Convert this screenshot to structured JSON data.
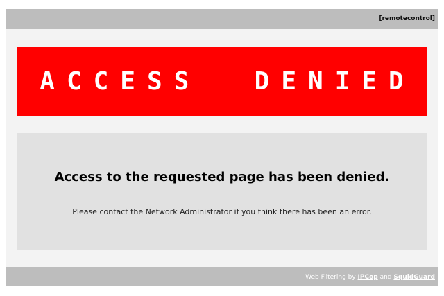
{
  "header": {
    "remote_link": "[remotecontrol]"
  },
  "banner": {
    "title": "ACCESS  DENIED"
  },
  "message": {
    "heading": "Access to the requested page has been denied.",
    "text": "Please contact the Network Administrator if you think there has been an error."
  },
  "footer": {
    "prefix": "Web Filtering by ",
    "link1": "IPCop",
    "middle": " and ",
    "link2": "SquidGuard"
  },
  "colors": {
    "banner": "#ff0000",
    "bars": "#bdbdbd",
    "message_box": "#e1e1e1",
    "frame": "#f3f3f3"
  }
}
